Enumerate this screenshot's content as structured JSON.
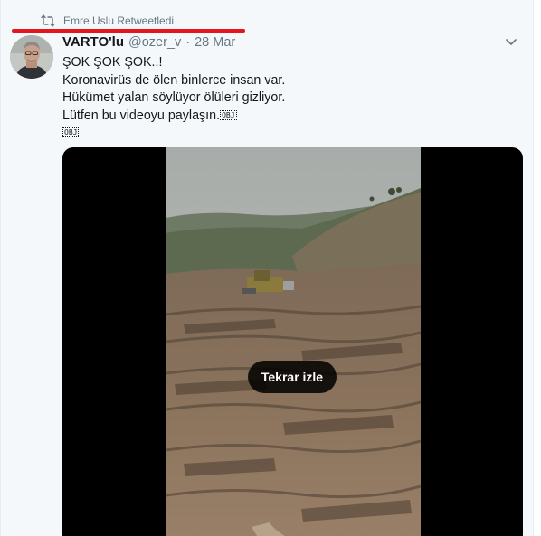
{
  "retweet": {
    "label": "Emre Uslu Retweetledi",
    "icon": "retweet-icon",
    "highlight_color": "#e3161b"
  },
  "author": {
    "name": "VARTO'lu",
    "handle": "@ozer_v",
    "separator": "·",
    "date": "28 Mar"
  },
  "body": {
    "lines": [
      "ŞOK ŞOK ŞOK..!",
      "Koronavirüs de ölen binlerce insan var.",
      "Hükümet yalan söylüyor ölüleri gizliyor.",
      "Lütfen bu videoyu paylaşın."
    ],
    "object_glyph": "OBJ"
  },
  "media": {
    "replay_label": "Tekrar izle"
  },
  "colors": {
    "secondary_text": "#657786",
    "background": "#f5f8fa"
  }
}
